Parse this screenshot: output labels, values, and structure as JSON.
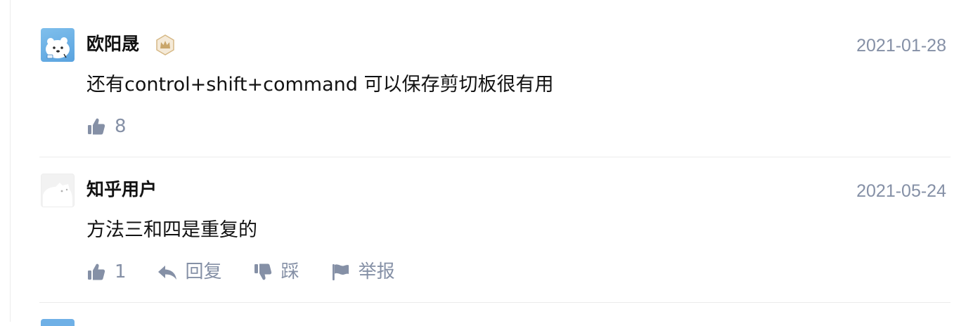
{
  "comments": [
    {
      "author": "欧阳晟",
      "date": "2021-01-28",
      "content": "还有control+shift+command 可以保存剪切板很有用",
      "likes": "8",
      "avatar_icon": "polar-bear-avatar",
      "badge_icon": "crown-badge-icon"
    },
    {
      "author": "知乎用户",
      "date": "2021-05-24",
      "content": "方法三和四是重复的",
      "likes": "1",
      "reply_label": "回复",
      "dislike_label": "踩",
      "report_label": "举报",
      "avatar_icon": "default-avatar"
    }
  ],
  "colors": {
    "meta_text": "#8590a6",
    "primary_text": "#121212",
    "badge_gold": "#c9a66b",
    "divider": "#ebebeb"
  }
}
